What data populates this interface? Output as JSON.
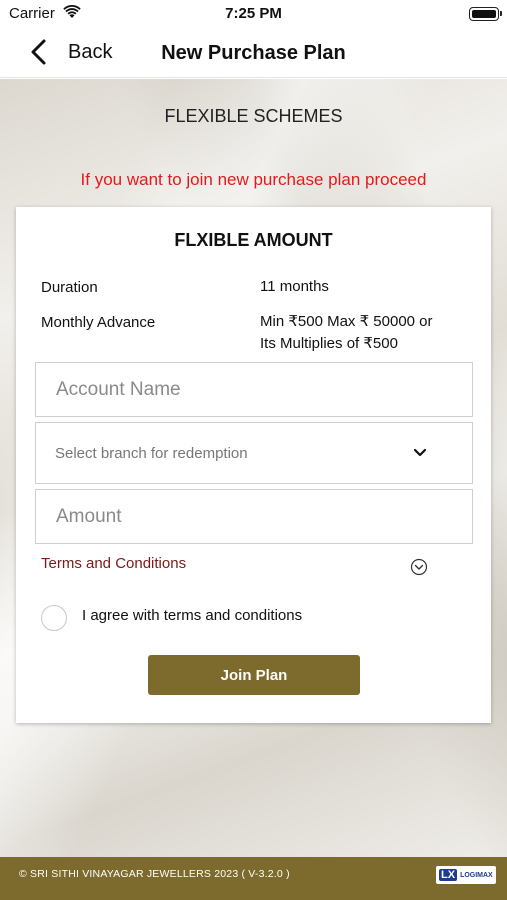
{
  "status_bar": {
    "carrier": "Carrier",
    "time": "7:25 PM"
  },
  "nav": {
    "back_label": "Back",
    "title": "New Purchase Plan"
  },
  "section_heading": "FLEXIBLE SCHEMES",
  "info_message": "If you want to join new purchase plan proceed",
  "card": {
    "title": "FLXIBLE AMOUNT",
    "duration_label": "Duration",
    "duration_value": "11 months",
    "advance_label": "Monthly Advance",
    "advance_value_line1": "Min ₹500 Max ₹ 50000 or",
    "advance_value_line2": "Its Multiplies of ₹500"
  },
  "form": {
    "account_name_placeholder": "Account Name",
    "account_name_value": "",
    "branch_placeholder": "Select branch for redemption",
    "amount_placeholder": "Amount",
    "amount_value": "",
    "terms_label": "Terms and Conditions",
    "agree_label": "I agree with terms and conditions",
    "agree_checked": false,
    "join_button_label": "Join Plan"
  },
  "footer": {
    "copyright": "© SRI SITHI VINAYAGAR JEWELLERS 2023 ( V-3.2.0 )",
    "logo_mark": "LX",
    "logo_text": "LOGIMAX"
  },
  "colors": {
    "brand": "#7d6a2d",
    "alert": "#e11b1b",
    "terms_link": "#7a1a1a"
  },
  "icons": [
    "wifi-icon",
    "battery-icon",
    "back-chevron-icon",
    "chevron-down-icon",
    "expand-circle-icon"
  ]
}
